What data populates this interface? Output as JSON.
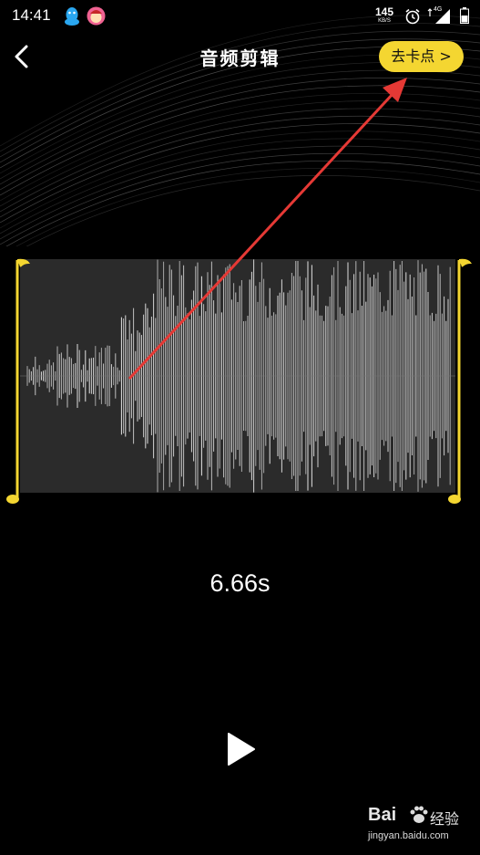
{
  "status_bar": {
    "time": "14:41",
    "net_speed_value": "145",
    "net_speed_unit": "KB/S",
    "network_type": "4G",
    "icons": [
      "qq-icon",
      "app-notification-icon",
      "alarm-icon",
      "signal-icon",
      "battery-icon"
    ]
  },
  "header": {
    "title": "音频剪辑",
    "back_icon": "chevron-left-icon",
    "beat_button_label": "去卡点 >"
  },
  "editor": {
    "duration": "6.66s",
    "waveform_color": "#e6e6e6",
    "waveform_background": "#2b2b2b",
    "handle_color": "#f4d631"
  },
  "playback": {
    "play_icon": "play-icon"
  },
  "watermark": {
    "brand": "Bai",
    "brand_suffix": "经验",
    "url": "jingyan.baidu.com"
  },
  "colors": {
    "accent": "#f4d631",
    "annotation_arrow": "#e53935",
    "background": "#000000"
  }
}
